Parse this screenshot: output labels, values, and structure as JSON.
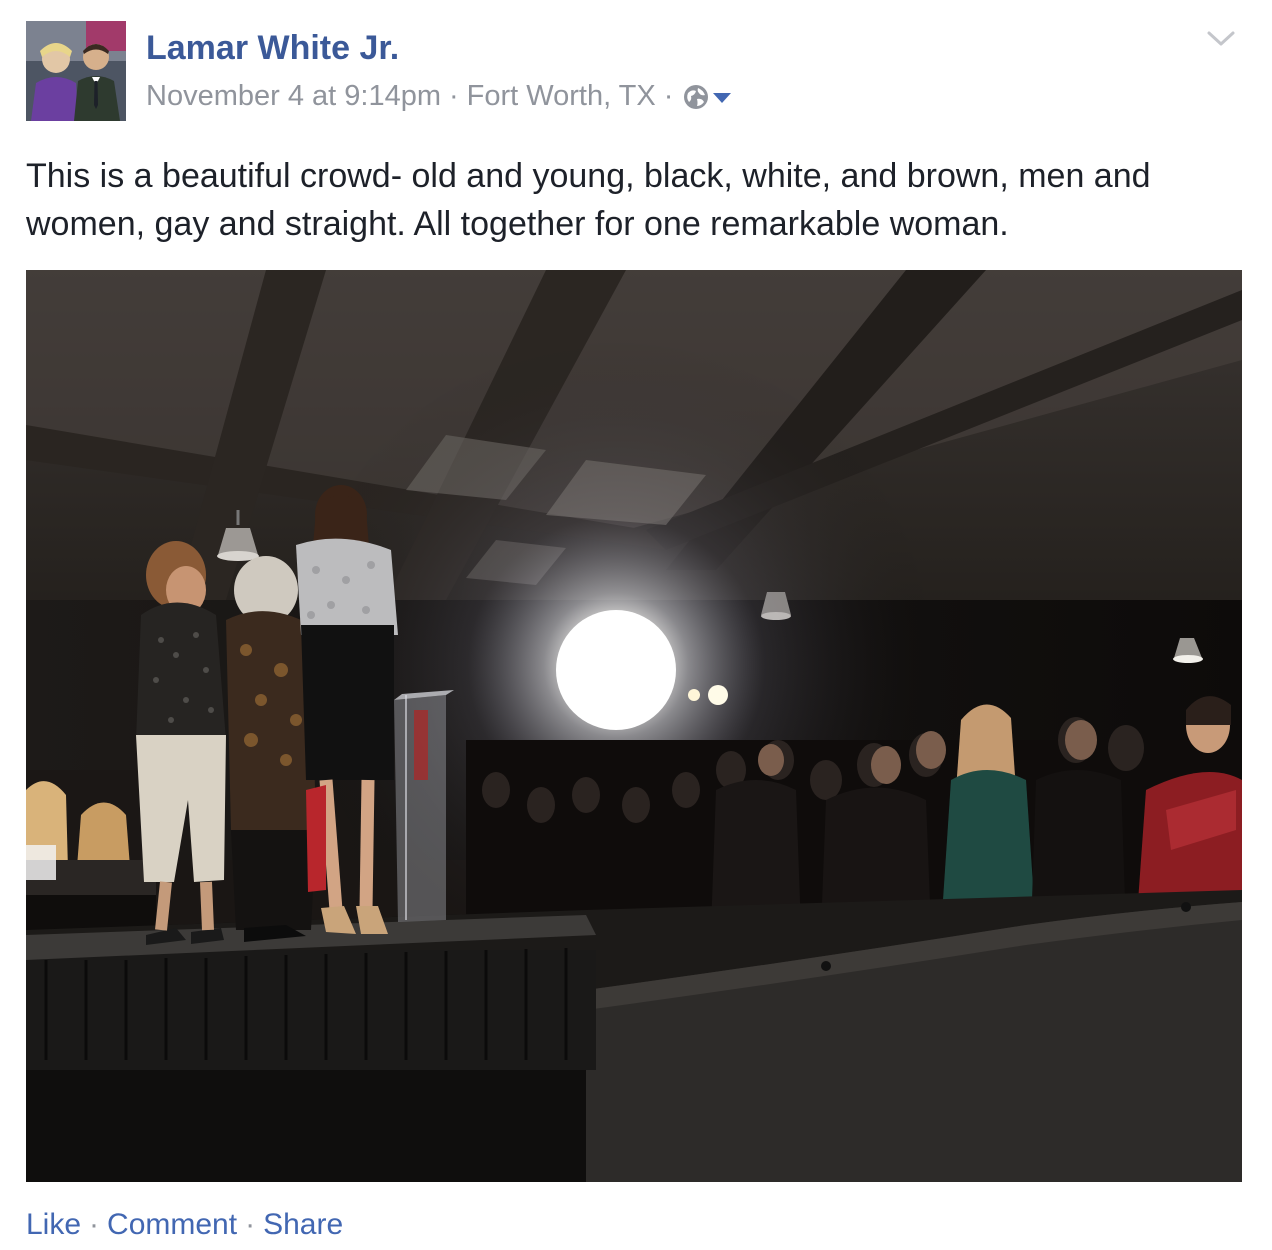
{
  "post": {
    "author_name": "Lamar White Jr.",
    "timestamp": "November 4 at 9:14pm",
    "location": "Fort Worth, TX",
    "separator": "·",
    "privacy_icon": "globe-icon",
    "menu_icon": "chevron-down-icon",
    "text": "This is a beautiful crowd- old and young, black, white, and brown, men and women, gay and straight. All together for one remarkable woman.",
    "photo_icon": "event-photo",
    "colors": {
      "link": "#3b5998",
      "action_link": "#4267b2",
      "meta": "#90949c",
      "text": "#1d2129"
    }
  },
  "actions": {
    "like": "Like",
    "comment": "Comment",
    "share": "Share",
    "separator": "·"
  }
}
